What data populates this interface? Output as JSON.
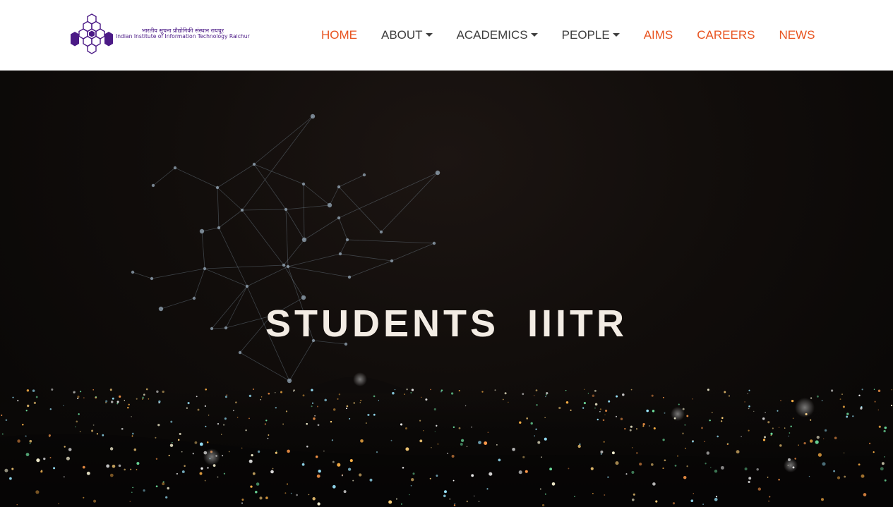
{
  "header": {
    "logo": {
      "hindi": "भारतीय सूचना प्रौद्योगिकी संस्थान रायचूर",
      "english": "Indian Institute of Information Technology Raichur"
    },
    "nav": [
      {
        "label": "HOME",
        "dropdown": false,
        "color": "#e8531f"
      },
      {
        "label": "ABOUT",
        "dropdown": true,
        "color": "#3d3d3d"
      },
      {
        "label": "ACADEMICS",
        "dropdown": true,
        "color": "#3d3d3d"
      },
      {
        "label": "PEOPLE",
        "dropdown": true,
        "color": "#3d3d3d"
      },
      {
        "label": "AIMS",
        "dropdown": false,
        "color": "#e8531f"
      },
      {
        "label": "CAREERS",
        "dropdown": false,
        "color": "#e8531f"
      },
      {
        "label": "NEWS",
        "dropdown": false,
        "color": "#e8531f"
      }
    ]
  },
  "hero": {
    "title": "STUDENTS  IIITR",
    "background": "night-city-skyline-with-network-graph"
  },
  "colors": {
    "accent": "#e8531f",
    "nav_text": "#3d3d3d",
    "logo_purple": "#4b1a86"
  }
}
